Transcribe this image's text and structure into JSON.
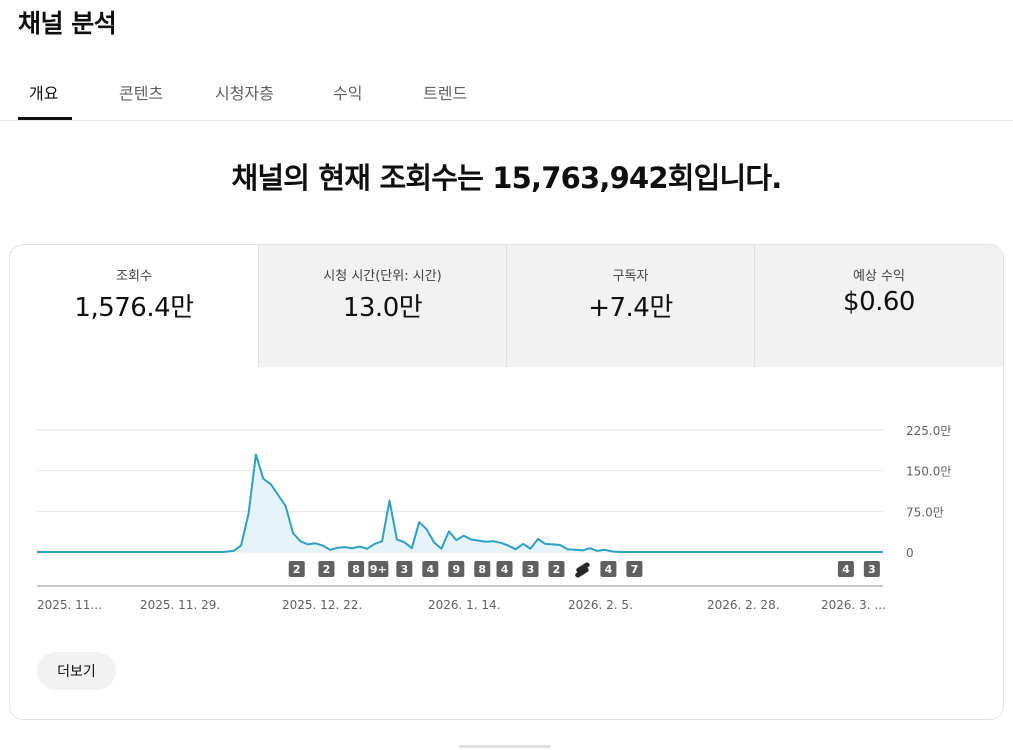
{
  "page": {
    "title": "채널 분석",
    "headline": "채널의 현재 조회수는 15,763,942회입니다."
  },
  "tabs": [
    {
      "label": "개요",
      "active": true
    },
    {
      "label": "콘텐츠",
      "active": false
    },
    {
      "label": "시청자층",
      "active": false
    },
    {
      "label": "수익",
      "active": false
    },
    {
      "label": "트렌드",
      "active": false
    }
  ],
  "metrics": [
    {
      "label": "조회수",
      "value": "1,576.4만",
      "selected": true
    },
    {
      "label": "시청 시간(단위: 시간)",
      "value": "13.0만",
      "selected": false
    },
    {
      "label": "구독자",
      "value": "+7.4만",
      "selected": false
    },
    {
      "label": "예상 수익",
      "value": "$0.60",
      "selected": false
    }
  ],
  "more_button": {
    "label": "더보기"
  },
  "colors": {
    "line": "#2ea0c4",
    "area": "#e6f3f8",
    "grid": "#e5e5e5",
    "axis": "#909090",
    "marker_bg": "#606060",
    "marker_text": "#ffffff"
  },
  "chart_data": {
    "type": "area",
    "ylim": [
      0,
      2250000
    ],
    "yticks": [
      0,
      750000,
      1500000,
      2250000
    ],
    "ytick_labels": [
      "0",
      "75.0만",
      "150.0만",
      "225.0만"
    ],
    "xtick_labels": [
      "2025. 11...",
      "2025. 11. 29.",
      "2025. 12. 22.",
      "2026. 1. 14.",
      "2026. 2. 5.",
      "2026. 2. 28.",
      "2026. 3. ..."
    ],
    "grid": true,
    "points": [
      [
        0,
        0
      ],
      [
        30,
        0
      ],
      [
        50,
        0
      ],
      [
        53,
        20000
      ],
      [
        55,
        120000
      ],
      [
        57,
        700000
      ],
      [
        59,
        1800000
      ],
      [
        61,
        1350000
      ],
      [
        63,
        1250000
      ],
      [
        65,
        1050000
      ],
      [
        67,
        850000
      ],
      [
        69,
        350000
      ],
      [
        71,
        200000
      ],
      [
        73,
        140000
      ],
      [
        75,
        160000
      ],
      [
        77,
        120000
      ],
      [
        79,
        40000
      ],
      [
        81,
        80000
      ],
      [
        83,
        90000
      ],
      [
        85,
        70000
      ],
      [
        87,
        100000
      ],
      [
        89,
        60000
      ],
      [
        91,
        150000
      ],
      [
        93,
        200000
      ],
      [
        95,
        950000
      ],
      [
        97,
        230000
      ],
      [
        99,
        180000
      ],
      [
        101,
        70000
      ],
      [
        103,
        550000
      ],
      [
        105,
        420000
      ],
      [
        107,
        180000
      ],
      [
        109,
        60000
      ],
      [
        111,
        380000
      ],
      [
        113,
        220000
      ],
      [
        115,
        300000
      ],
      [
        117,
        230000
      ],
      [
        119,
        210000
      ],
      [
        121,
        190000
      ],
      [
        123,
        200000
      ],
      [
        125,
        170000
      ],
      [
        127,
        120000
      ],
      [
        129,
        50000
      ],
      [
        131,
        150000
      ],
      [
        133,
        60000
      ],
      [
        135,
        240000
      ],
      [
        137,
        150000
      ],
      [
        139,
        140000
      ],
      [
        141,
        130000
      ],
      [
        143,
        50000
      ],
      [
        145,
        40000
      ],
      [
        147,
        30000
      ],
      [
        149,
        70000
      ],
      [
        151,
        20000
      ],
      [
        153,
        40000
      ],
      [
        155,
        10000
      ],
      [
        157,
        0
      ],
      [
        160,
        0
      ],
      [
        200,
        0
      ],
      [
        228,
        0
      ]
    ],
    "markers": [
      {
        "x": 70,
        "label": "2",
        "type": "count"
      },
      {
        "x": 78,
        "label": "2",
        "type": "count"
      },
      {
        "x": 86,
        "label": "8",
        "type": "count"
      },
      {
        "x": 92,
        "label": "9+",
        "type": "count"
      },
      {
        "x": 99,
        "label": "3",
        "type": "count"
      },
      {
        "x": 106,
        "label": "4",
        "type": "count"
      },
      {
        "x": 113,
        "label": "9",
        "type": "count"
      },
      {
        "x": 120,
        "label": "8",
        "type": "count"
      },
      {
        "x": 126,
        "label": "4",
        "type": "count"
      },
      {
        "x": 133,
        "label": "3",
        "type": "count"
      },
      {
        "x": 140,
        "label": "2",
        "type": "count"
      },
      {
        "x": 147,
        "label": "shorts-icon",
        "type": "icon"
      },
      {
        "x": 154,
        "label": "4",
        "type": "count"
      },
      {
        "x": 161,
        "label": "7",
        "type": "count"
      },
      {
        "x": 218,
        "label": "4",
        "type": "count"
      },
      {
        "x": 225,
        "label": "3",
        "type": "count"
      }
    ]
  }
}
